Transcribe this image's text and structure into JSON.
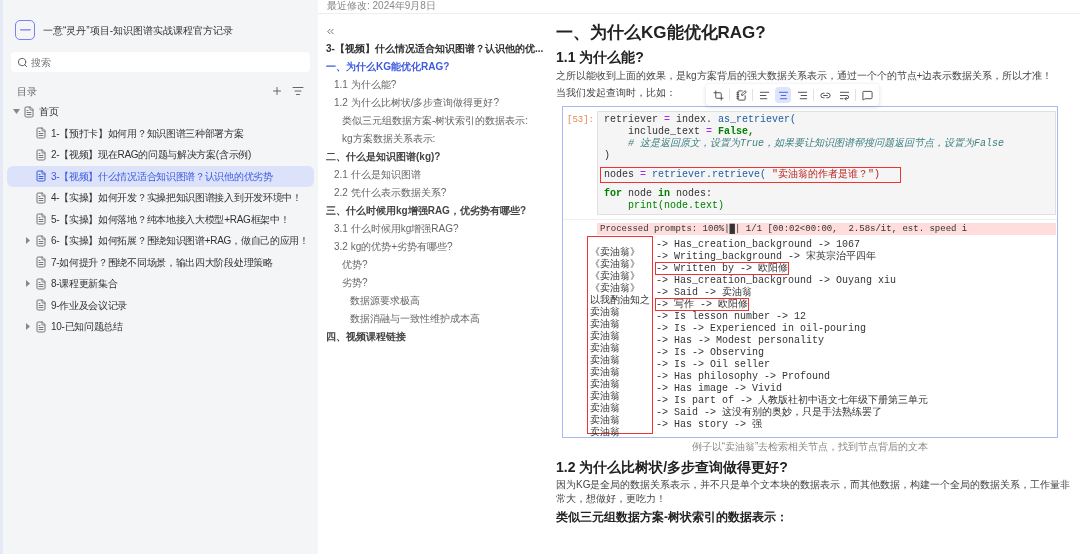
{
  "sidebar": {
    "logo": "一",
    "title": "一意“灵丹”项目-知识图谱实战课程官方记录",
    "search": {
      "placeholder": "搜索"
    },
    "toc_label": "目录",
    "tree": [
      {
        "label": "首页",
        "selected": false,
        "has_children": true,
        "expanded": true,
        "children": [
          {
            "label": "1-【预打卡】如何用？知识图谱三种部署方案",
            "selected": false,
            "has_children": false
          },
          {
            "label": "2-【视频】现在RAG的问题与解决方案(含示例)",
            "selected": false,
            "has_children": false
          },
          {
            "label": "3-【视频】什么情况适合知识图谱？认识他的优劣势",
            "selected": true,
            "has_children": false
          },
          {
            "label": "4-【实操】如何开发？实操把知识图谱接入到开发环境中！",
            "selected": false,
            "has_children": false
          },
          {
            "label": "5-【实操】如何落地？纯本地接入大模型+RAG框架中！",
            "selected": false,
            "has_children": false
          },
          {
            "label": "6-【实操】如何拓展？围绕知识图谱+RAG，做自己的应用！",
            "selected": false,
            "has_children": true,
            "expanded": false
          },
          {
            "label": "7-如何提升？围绕不同场景，输出四大阶段处理策略",
            "selected": false,
            "has_children": false
          },
          {
            "label": "8-课程更新集合",
            "selected": false,
            "has_children": true,
            "expanded": false
          },
          {
            "label": "9-作业及会议记录",
            "selected": false,
            "has_children": false
          },
          {
            "label": "10-已知问题总结",
            "selected": false,
            "has_children": true,
            "expanded": false
          }
        ]
      }
    ]
  },
  "last_modified": "最近修改: 2024年9月8日",
  "outline": {
    "title": "3-【视频】什么情况适合知识图谱？认识他的优...",
    "items": [
      {
        "label": "一、为什么KG能优化RAG?",
        "selected": true,
        "children": [
          {
            "label": "1.1 为什么能?",
            "selected": false
          },
          {
            "label": "1.2 为什么比树状/多步查询做得更好?",
            "selected": false,
            "children": [
              {
                "label": "类似三元组数据方案-树状索引的数据表示:",
                "selected": false
              },
              {
                "label": "kg方案数据关系表示:",
                "selected": false
              }
            ]
          }
        ]
      },
      {
        "label": "二、什么是知识图谱(kg)?",
        "selected": false,
        "children": [
          {
            "label": "2.1 什么是知识图谱",
            "selected": false
          },
          {
            "label": "2.2 凭什么表示数据关系?",
            "selected": false
          }
        ]
      },
      {
        "label": "三、什么时候用kg增强RAG，优劣势有哪些?",
        "selected": false,
        "children": [
          {
            "label": "3.1 什么时候用kg增强RAG?",
            "selected": false
          },
          {
            "label": "3.2 kg的优势+劣势有哪些?",
            "selected": false,
            "children": [
              {
                "label": "优势?",
                "selected": false
              },
              {
                "label": "劣势?",
                "selected": false,
                "children": [
                  {
                    "label": "数据源要求极高",
                    "selected": false
                  },
                  {
                    "label": "数据消融与一致性维护成本高",
                    "selected": false
                  }
                ]
              }
            ]
          }
        ]
      },
      {
        "label": "四、视频课程链接",
        "selected": false
      }
    ]
  },
  "document": {
    "h1": "一、为什么KG能优化RAG?",
    "h2": "1.1 为什么能?",
    "p1": "之所以能收到上面的效果，是kg方案背后的强大数据关系表示，通过一个个的节点+边表示数据关系，所以才准！",
    "p2": "当我们发起查询时，比如：",
    "image_toolbar": [
      {
        "kind": "crop",
        "selected": false
      },
      {
        "kind": "note",
        "selected": false
      },
      {
        "kind": "align-left",
        "selected": false
      },
      {
        "kind": "align-center",
        "selected": true
      },
      {
        "kind": "align-right",
        "selected": false
      },
      {
        "kind": "link",
        "selected": false
      },
      {
        "kind": "wrap",
        "selected": false
      },
      {
        "kind": "comment",
        "selected": false
      }
    ],
    "notebook": {
      "prompt": "[53]:",
      "code": [
        [
          {
            "highlighted": false,
            "indented": false,
            "tokens": [
              {
                "t": "retriever",
                "kind": "plain"
              },
              {
                "t": "=",
                "kind": "op"
              },
              {
                "t": "index.",
                "kind": "plain"
              },
              {
                "t": "as_retriever(",
                "kind": "fn"
              }
            ]
          },
          {
            "highlighted": false,
            "indented": true,
            "tokens": [
              {
                "t": "include_text",
                "kind": "plain"
              },
              {
                "t": "=",
                "kind": "op"
              },
              {
                "t": "False,",
                "kind": "kw"
              },
              {
                "t": "# 这是返回原文，设置为True，如果要让知识图谱帮搜问题返回节点，设置为False",
                "kind": "comment"
              }
            ]
          },
          {
            "highlighted": false,
            "indented": false,
            "tokens": [
              {
                "t": ")",
                "kind": "plain"
              }
            ]
          }
        ],
        [
          {
            "highlighted": true,
            "indented": false,
            "tokens": [
              {
                "t": "nodes",
                "kind": "plain"
              },
              {
                "t": "=",
                "kind": "op"
              },
              {
                "t": "retriever.retrieve(",
                "kind": "fn"
              },
              {
                "t": "\"卖油翁的作者是谁？\")",
                "kind": "string"
              }
            ]
          }
        ],
        [
          {
            "highlighted": false,
            "indented": false,
            "tokens": [
              {
                "t": "for",
                "kind": "kw"
              },
              {
                "t": "node",
                "kind": "plain"
              },
              {
                "t": "in",
                "kind": "kw"
              },
              {
                "t": "nodes:",
                "kind": "plain"
              }
            ]
          },
          {
            "highlighted": false,
            "indented": true,
            "tokens": [
              {
                "t": "print(node.text)",
                "kind": "builtin"
              }
            ]
          }
        ]
      ],
      "progress": "Processed prompts: 100%|█| 1/1 [00:02<00:00,  2.58s/it, est. speed i",
      "output": [
        {
          "subject": "《卖油翁》",
          "rest": "-> Has_creation_background -> 1067",
          "highlighted": false
        },
        {
          "subject": "《卖油翁》",
          "rest": "-> Writing_background -> 宋英宗治平四年",
          "highlighted": false
        },
        {
          "subject": "《卖油翁》",
          "rest": "-> Written by -> 欧阳修",
          "highlighted": true
        },
        {
          "subject": "《卖油翁》",
          "rest": "-> Has_creation_background -> Ouyang xiu",
          "highlighted": false
        },
        {
          "subject": "以我酌油知之",
          "rest": "-> Said -> 卖油翁",
          "highlighted": false
        },
        {
          "subject": "卖油翁",
          "rest": "-> 写作 -> 欧阳修",
          "highlighted": true
        },
        {
          "subject": "卖油翁",
          "rest": "-> Is lesson number -> 12",
          "highlighted": false
        },
        {
          "subject": "卖油翁",
          "rest": "-> Is -> Experienced in oil-pouring",
          "highlighted": false
        },
        {
          "subject": "卖油翁",
          "rest": "-> Has -> Modest personality",
          "highlighted": false
        },
        {
          "subject": "卖油翁",
          "rest": "-> Is -> Observing",
          "highlighted": false
        },
        {
          "subject": "卖油翁",
          "rest": "-> Is -> Oil seller",
          "highlighted": false
        },
        {
          "subject": "卖油翁",
          "rest": "-> Has philosophy -> Profound",
          "highlighted": false
        },
        {
          "subject": "卖油翁",
          "rest": "-> Has image -> Vivid",
          "highlighted": false
        },
        {
          "subject": "卖油翁",
          "rest": "-> Is part of -> 人教版社初中语文七年级下册第三单元",
          "highlighted": false
        },
        {
          "subject": "卖油翁",
          "rest": "-> Said -> 这没有别的奥妙，只是手法熟练罢了",
          "highlighted": false
        },
        {
          "subject": "卖油翁",
          "rest": "-> Has story -> 强",
          "highlighted": false
        }
      ]
    },
    "caption": "例子以“卖油翁”去检索相关节点，找到节点背后的文本",
    "h2b": "1.2 为什么比树状/多步查询做得更好?",
    "p3": "因为KG是全局的数据关系表示，并不只是单个文本块的数据表示，而其他数据，构建一个全局的数据关系，工作量非常大，想做好，更吃力！",
    "h3": "类似三元组数据方案-树状索引的数据表示："
  }
}
